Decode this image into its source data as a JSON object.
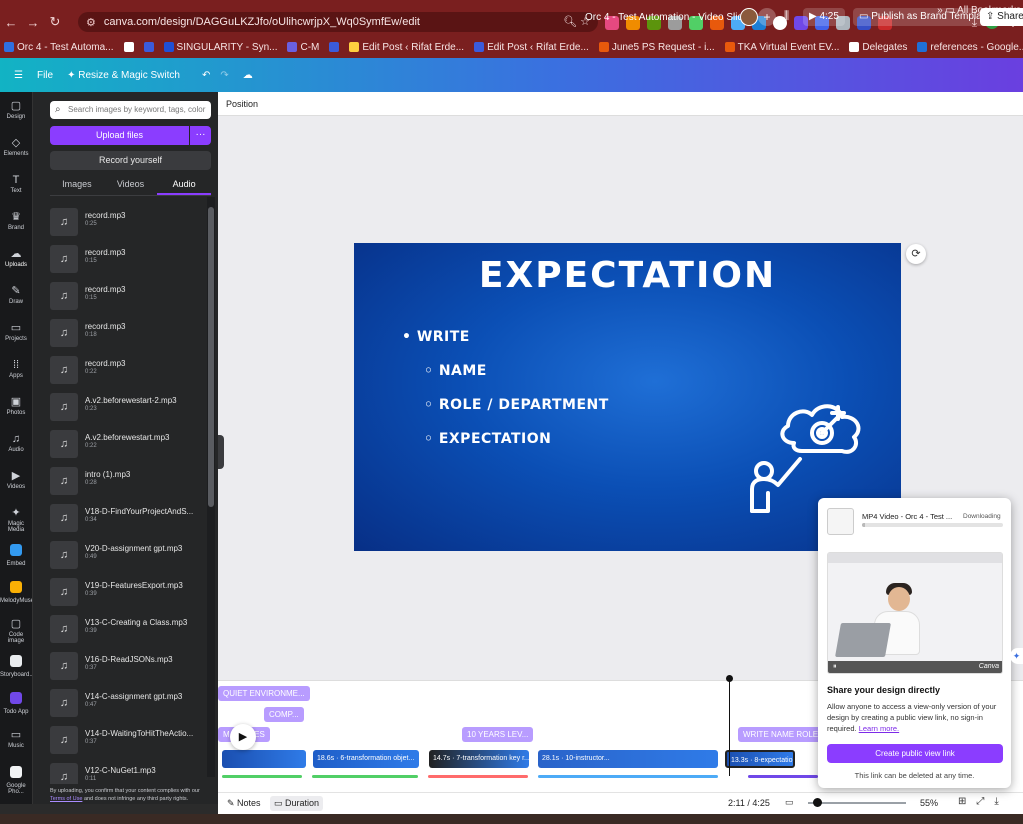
{
  "browser": {
    "url": "canva.com/design/DAGGuLKZJfo/oUlihcwrjpX_Wq0SymfEw/edit",
    "bookmarks": [
      {
        "label": "Orc 4 - Test Automa...",
        "color": "#2f6fe0"
      },
      {
        "label": "",
        "color": "#ffffff"
      },
      {
        "label": "",
        "color": "#3b5bdb"
      },
      {
        "label": "SINGULARITY - Syn...",
        "color": "#1f4fd6"
      },
      {
        "label": "C-M",
        "color": "#6a5fe0"
      },
      {
        "label": "",
        "color": "#3b5bdb"
      },
      {
        "label": "Edit Post ‹ Rifat Erde...",
        "color": "#ffcf3f"
      },
      {
        "label": "Edit Post ‹ Rifat Erde...",
        "color": "#3b5bdb"
      },
      {
        "label": "June5 PS Request - i...",
        "color": "#e8590c"
      },
      {
        "label": "TKA Virtual Event EV...",
        "color": "#e8590c"
      },
      {
        "label": "Delegates",
        "color": "#ffffff"
      },
      {
        "label": "references - Google...",
        "color": "#1f6fd6"
      }
    ],
    "all_bookmarks": "All Bookmarks"
  },
  "header": {
    "file": "File",
    "resize": "Resize & Magic Switch",
    "title": "Orc 4 - Test Automation - Video Slides",
    "plus": "+",
    "play_time": "4:25",
    "publish": "Publish as Brand Template",
    "share": "Share"
  },
  "rail": [
    {
      "label": "Design",
      "icon": "▢"
    },
    {
      "label": "Elements",
      "icon": "◇"
    },
    {
      "label": "Text",
      "icon": "T"
    },
    {
      "label": "Brand",
      "icon": "♛"
    },
    {
      "label": "Uploads",
      "icon": "☁"
    },
    {
      "label": "Draw",
      "icon": "✎"
    },
    {
      "label": "Projects",
      "icon": "▭"
    },
    {
      "label": "Apps",
      "icon": "⁞⁞"
    },
    {
      "label": "Photos",
      "icon": "▣"
    },
    {
      "label": "Audio",
      "icon": "♫"
    },
    {
      "label": "Videos",
      "icon": "▶"
    },
    {
      "label": "Magic Media",
      "icon": "✦"
    },
    {
      "label": "Embed",
      "icon": "■"
    },
    {
      "label": "MelodyMuse",
      "icon": "■"
    },
    {
      "label": "Code image",
      "icon": "▢"
    },
    {
      "label": "Storyboard...",
      "icon": "■"
    },
    {
      "label": "Todo App",
      "icon": "■"
    },
    {
      "label": "Music",
      "icon": "▭"
    },
    {
      "label": "Google Pho...",
      "icon": "■"
    }
  ],
  "panel": {
    "search_placeholder": "Search images by keyword, tags, color",
    "upload_label": "Upload files",
    "more_label": "···",
    "record_label": "Record yourself",
    "tabs": [
      "Images",
      "Videos",
      "Audio"
    ],
    "items": [
      {
        "name": "record.mp3",
        "duration": "0:25"
      },
      {
        "name": "record.mp3",
        "duration": "0:15"
      },
      {
        "name": "record.mp3",
        "duration": "0:15"
      },
      {
        "name": "record.mp3",
        "duration": "0:18"
      },
      {
        "name": "record.mp3",
        "duration": "0:22"
      },
      {
        "name": "A.v2.beforewestart-2.mp3",
        "duration": "0:23"
      },
      {
        "name": "A.v2.beforewestart.mp3",
        "duration": "0:22"
      },
      {
        "name": "intro (1).mp3",
        "duration": "0:28"
      },
      {
        "name": "V18-D-FindYourProjectAndS...",
        "duration": "0:34"
      },
      {
        "name": "V20-D-assignment gpt.mp3",
        "duration": "0:49"
      },
      {
        "name": "V19-D-FeaturesExport.mp3",
        "duration": "0:39"
      },
      {
        "name": "V13-C-Creating a Class.mp3",
        "duration": "0:39"
      },
      {
        "name": "V16-D-ReadJSONs.mp3",
        "duration": "0:37"
      },
      {
        "name": "V14-C-assignment gpt.mp3",
        "duration": "0:47"
      },
      {
        "name": "V14-D-WaitingToHitTheActio...",
        "duration": "0:37"
      },
      {
        "name": "V12-C-NuGet1.mp3",
        "duration": "0:11"
      }
    ],
    "terms_prefix": "By uploading, you confirm that your content complies with our",
    "terms_link": "Terms of Use",
    "terms_suffix": "and does not infringe any third party rights."
  },
  "workspace": {
    "position_label": "Position"
  },
  "slide": {
    "title": "EXPECTATION",
    "bullets": [
      {
        "text": "WRITE",
        "marker": "•",
        "level": 0
      },
      {
        "text": "NAME",
        "marker": "◦",
        "level": 1
      },
      {
        "text": "ROLE / DEPARTMENT",
        "marker": "◦",
        "level": 1
      },
      {
        "text": "EXPECTATION",
        "marker": "◦",
        "level": 1
      }
    ]
  },
  "timeline": {
    "tags": [
      {
        "label": "QUIET ENVIRONME..."
      },
      {
        "label": "COMP..."
      },
      {
        "label": "M   SSAGES"
      },
      {
        "label": "10 YEARS LEV..."
      },
      {
        "label": "WRITE NAME ROLE ..."
      }
    ],
    "clips": [
      {
        "label": "",
        "color": "#1b4fb0"
      },
      {
        "label": "18.6s · 6-transformation objet...",
        "color": "#1f5ec8"
      },
      {
        "label": "14.7s · 7-transformation key r...",
        "color": "#222"
      },
      {
        "label": "28.1s · 10-instructor...",
        "color": "#2a63c9"
      },
      {
        "label": "13.3s · 8-expectation",
        "color": "#1b4fb0"
      }
    ]
  },
  "footer": {
    "notes": "Notes",
    "duration": "Duration",
    "time": "2:11 / 4:25",
    "zoom": "55%",
    "zoom_fraction": 0.05
  },
  "popup": {
    "title": "MP4 Video - Orc 4 - Test ...",
    "status": "Downloading",
    "progress": 0.02,
    "video_brand": "Canva",
    "heading": "Share your design directly",
    "desc": "Allow anyone to access a view-only version of your design by creating a public view link, no sign-in required.",
    "learn_more": "Learn more.",
    "button": "Create public view link",
    "note": "This link can be deleted at any time."
  }
}
